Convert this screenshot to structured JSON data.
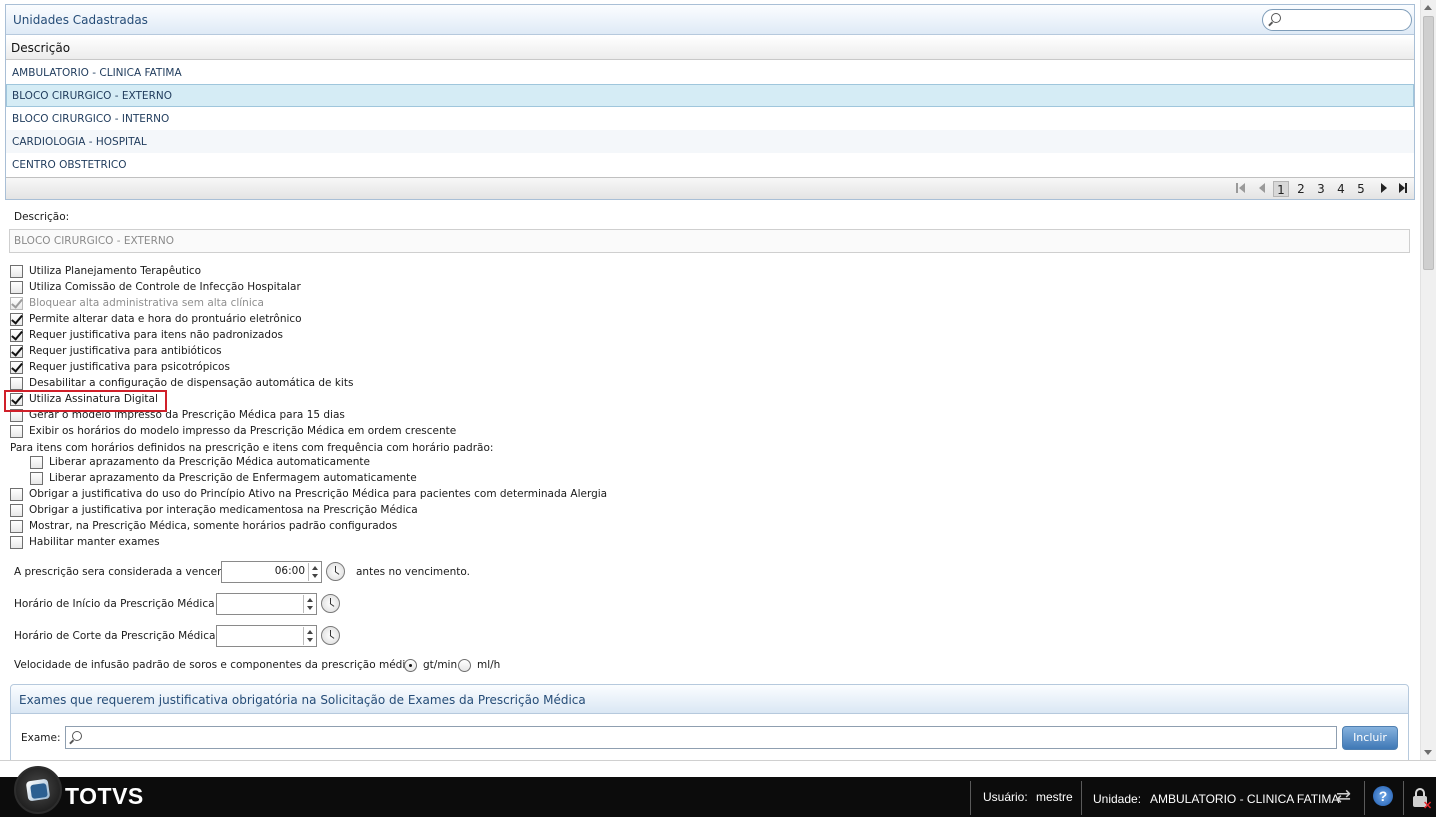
{
  "units_panel": {
    "title": "Unidades Cadastradas",
    "search_placeholder": "",
    "column_header": "Descrição",
    "rows": [
      "AMBULATORIO - CLINICA FATIMA",
      "BLOCO CIRURGICO - EXTERNO",
      "BLOCO CIRURGICO - INTERNO",
      "CARDIOLOGIA - HOSPITAL",
      "CENTRO OBSTETRICO"
    ],
    "selected_index": 1,
    "pages": [
      "1",
      "2",
      "3",
      "4",
      "5"
    ],
    "active_page": "1"
  },
  "form": {
    "description_label": "Descrição:",
    "description_value": "BLOCO CIRURGICO - EXTERNO",
    "checkboxes": [
      {
        "label": "Utiliza Planejamento Terapêutico",
        "checked": false,
        "disabled": false
      },
      {
        "label": "Utiliza Comissão de Controle de Infecção Hospitalar",
        "checked": false,
        "disabled": false
      },
      {
        "label": "Bloquear alta administrativa sem alta clínica",
        "checked": true,
        "disabled": true
      },
      {
        "label": "Permite alterar data e hora do prontuário eletrônico",
        "checked": true,
        "disabled": false
      },
      {
        "label": "Requer justificativa para itens não padronizados",
        "checked": true,
        "disabled": false
      },
      {
        "label": "Requer justificativa para antibióticos",
        "checked": true,
        "disabled": false
      },
      {
        "label": "Requer justificativa para psicotrópicos",
        "checked": true,
        "disabled": false
      },
      {
        "label": "Desabilitar a configuração de dispensação automática de kits",
        "checked": false,
        "disabled": false
      },
      {
        "label": "Utiliza Assinatura Digital",
        "checked": true,
        "disabled": false
      },
      {
        "label": "Gerar o modelo impresso da Prescrição Médica para 15 dias",
        "checked": false,
        "disabled": false
      },
      {
        "label": "Exibir os horários do modelo impresso da Prescrição Médica em ordem crescente",
        "checked": false,
        "disabled": false
      }
    ],
    "group_label": "Para itens com horários definidos na prescrição e itens com frequência com horário padrão:",
    "sub_checkboxes": [
      {
        "label": "Liberar aprazamento da Prescrição Médica automaticamente",
        "checked": false
      },
      {
        "label": "Liberar aprazamento da Prescrição de Enfermagem automaticamente",
        "checked": false
      }
    ],
    "checkboxes2": [
      {
        "label": "Obrigar a justificativa do uso do Princípio Ativo na Prescrição Médica para pacientes com determinada Alergia",
        "checked": false
      },
      {
        "label": "Obrigar a justificativa por interação medicamentosa na Prescrição Médica",
        "checked": false
      },
      {
        "label": "Mostrar, na Prescrição Médica, somente horários padrão configurados",
        "checked": false
      },
      {
        "label": "Habilitar manter exames",
        "checked": false
      }
    ],
    "expire_label": "A prescrição sera considerada a vencer",
    "expire_value": "06:00",
    "expire_suffix": "antes no vencimento.",
    "start_label": "Horário de Início da Prescrição Médica",
    "start_value": "",
    "cut_label": "Horário de Corte da Prescrição Médica",
    "cut_value": "",
    "infusion_label": "Velocidade de infusão padrão de soros e componentes da prescrição médica",
    "infusion_options": [
      "gt/min",
      "ml/h"
    ],
    "infusion_selected": "gt/min"
  },
  "exams_panel": {
    "title": "Exames que requerem justificativa obrigatória na Solicitação de Exames da Prescrição Médica",
    "exam_label": "Exame:",
    "exam_value": "",
    "include_label": "Incluir"
  },
  "footer": {
    "brand": "TOTVS",
    "user_label": "Usuário:",
    "user_value": "mestre",
    "unit_label": "Unidade:",
    "unit_value": "AMBULATORIO - CLINICA FATIMA",
    "help_glyph": "?"
  },
  "colors": {
    "highlight_box": "#d0202a",
    "selected_row": "#d5ecf5",
    "panel_title": "#264d78",
    "footer_bg": "#0c0c0c"
  }
}
